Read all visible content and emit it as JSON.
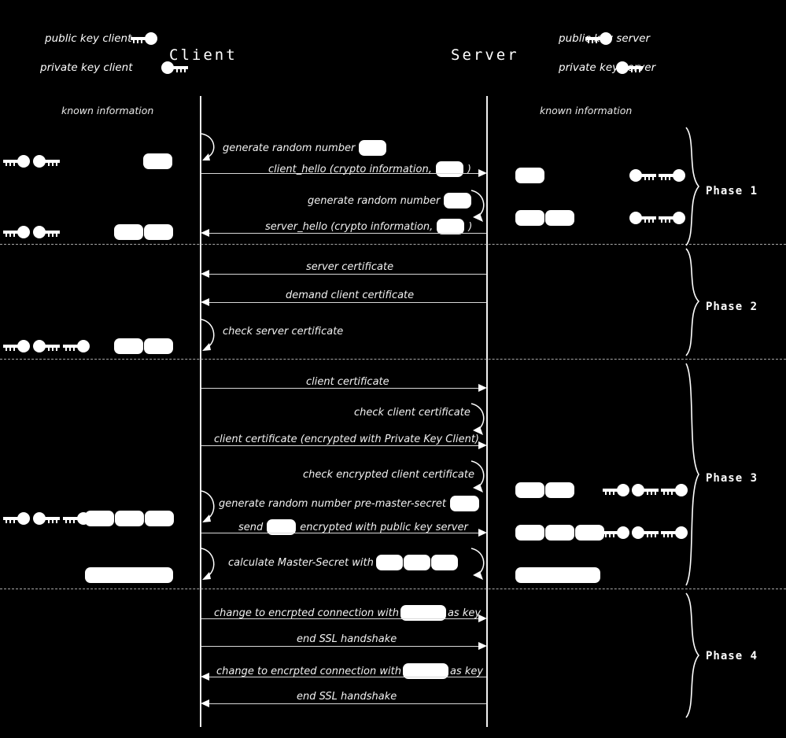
{
  "diagram": {
    "title_client": "Client",
    "title_server": "Server",
    "known_information_left": "known information",
    "known_information_right": "known information"
  },
  "legend": {
    "client": [
      {
        "label": "public key client",
        "icon": "public-key-icon"
      },
      {
        "label": "private key client",
        "icon": "private-key-icon"
      }
    ],
    "server": [
      {
        "label": "public key server",
        "icon": "public-key-icon"
      },
      {
        "label": "private key server",
        "icon": "private-key-icon"
      }
    ]
  },
  "phases": [
    {
      "name": "Phase 1"
    },
    {
      "name": "Phase 2"
    },
    {
      "name": "Phase 3"
    },
    {
      "name": "Phase 4"
    }
  ],
  "messages": [
    {
      "id": "m1",
      "kind": "self-client",
      "text_before": "generate random number",
      "text_after": "",
      "boxes": 1
    },
    {
      "id": "m2",
      "kind": "c2s",
      "text_before": "client_hello (crypto information,",
      "text_after": ")",
      "boxes": 1
    },
    {
      "id": "m3",
      "kind": "self-server",
      "text_before": "generate random number",
      "text_after": "",
      "boxes": 1
    },
    {
      "id": "m4",
      "kind": "s2c",
      "text_before": "server_hello (crypto information,",
      "text_after": ")",
      "boxes": 1
    },
    {
      "id": "m5",
      "kind": "s2c",
      "text_before": "server certificate",
      "text_after": "",
      "boxes": 0
    },
    {
      "id": "m6",
      "kind": "s2c",
      "text_before": "demand client certificate",
      "text_after": "",
      "boxes": 0
    },
    {
      "id": "m7",
      "kind": "self-client",
      "text_before": "check server certificate",
      "text_after": "",
      "boxes": 0
    },
    {
      "id": "m8",
      "kind": "c2s",
      "text_before": "client certificate",
      "text_after": "",
      "boxes": 0
    },
    {
      "id": "m9",
      "kind": "self-server",
      "text_before": "check client certificate",
      "text_after": "",
      "boxes": 0
    },
    {
      "id": "m10",
      "kind": "c2s",
      "text_before": "client certificate (encrypted with Private Key Client)",
      "text_after": "",
      "boxes": 0
    },
    {
      "id": "m11",
      "kind": "self-server",
      "text_before": "check encrypted client certificate",
      "text_after": "",
      "boxes": 0
    },
    {
      "id": "m12",
      "kind": "self-client",
      "text_before": "generate random number pre-master-secret",
      "text_after": "",
      "boxes": 1
    },
    {
      "id": "m13",
      "kind": "c2s",
      "text_before": "send",
      "text_after": "encrypted with public key server",
      "boxes": 1
    },
    {
      "id": "m14",
      "kind": "self-both",
      "text_before": "calculate Master-Secret with",
      "text_after": "",
      "boxes": 3
    },
    {
      "id": "m15",
      "kind": "c2s",
      "text_before": "change to encrpted connection with",
      "text_after": "as key",
      "boxes": 1
    },
    {
      "id": "m16",
      "kind": "c2s",
      "text_before": "end SSL handshake",
      "text_after": "",
      "boxes": 0
    },
    {
      "id": "m17",
      "kind": "s2c",
      "text_before": "change to encrpted connection with",
      "text_after": "as key",
      "boxes": 1
    },
    {
      "id": "m18",
      "kind": "s2c",
      "text_before": "end SSL handshake",
      "text_after": "",
      "boxes": 0
    }
  ],
  "client_state": [
    {
      "id": "cs1",
      "keys": [
        "public-key-client",
        "private-key-client"
      ],
      "boxes": 1
    },
    {
      "id": "cs2",
      "keys": [
        "public-key-client",
        "private-key-client"
      ],
      "boxes": 2
    },
    {
      "id": "cs3",
      "keys": [
        "public-key-client",
        "private-key-client",
        "public-key-server"
      ],
      "boxes": 2
    },
    {
      "id": "cs4",
      "keys": [
        "public-key-client",
        "private-key-client",
        "public-key-server"
      ],
      "boxes": 3
    },
    {
      "id": "cs5",
      "keys": [],
      "boxes": 1,
      "wide": true
    }
  ],
  "server_state": [
    {
      "id": "ss1",
      "boxes": 1,
      "keys": [
        "private-key-server",
        "public-key-server"
      ]
    },
    {
      "id": "ss2",
      "boxes": 2,
      "keys": [
        "private-key-server",
        "public-key-server"
      ]
    },
    {
      "id": "ss3",
      "boxes": 2,
      "keys": [
        "public-key-client",
        "private-key-server",
        "public-key-server"
      ]
    },
    {
      "id": "ss4",
      "boxes": 3,
      "keys": [
        "public-key-client",
        "private-key-server",
        "public-key-server"
      ]
    },
    {
      "id": "ss5",
      "boxes": 1,
      "keys": [],
      "wide": true
    }
  ],
  "colors": {
    "background": "#000000",
    "foreground": "#ffffff",
    "line": "#d8d8d8",
    "separator": "#a9a9a9"
  }
}
